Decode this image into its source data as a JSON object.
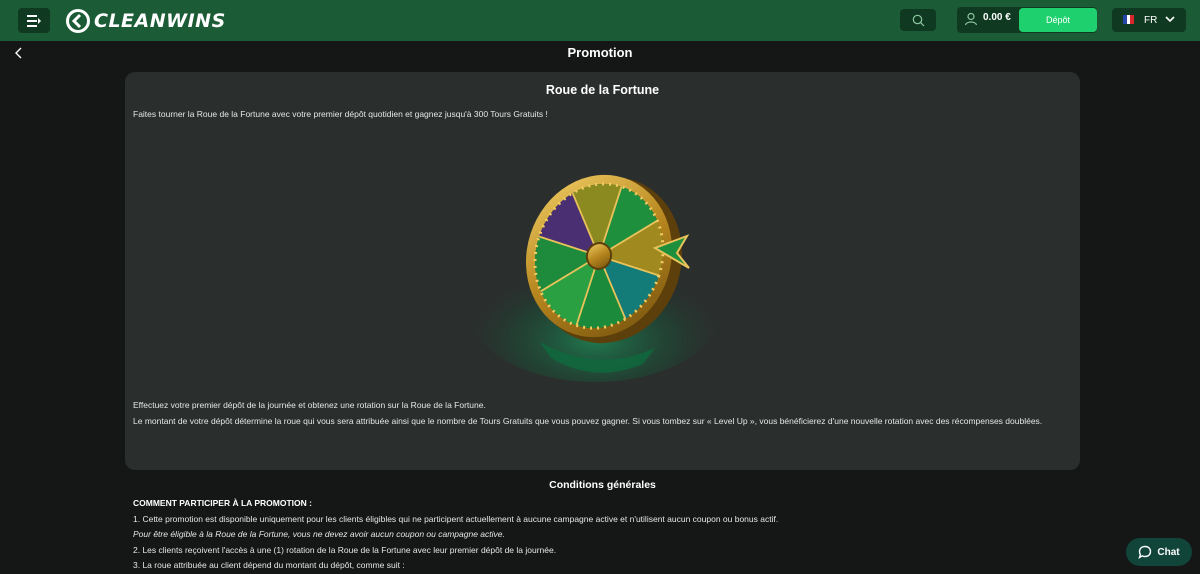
{
  "header": {
    "logo_text": "CLEANWINS",
    "balance": "0.00 €",
    "deposit_label": "Dépôt",
    "language": "FR",
    "icons": {
      "menu": "menu-icon",
      "search": "search-icon",
      "user": "user-icon",
      "flag": "france-flag-icon",
      "chevron": "chevron-down-icon"
    }
  },
  "page": {
    "title": "Promotion"
  },
  "card": {
    "title": "Roue de la Fortune",
    "intro": "Faites tourner la Roue de la Fortune avec votre premier dépôt quotidien et gagnez jusqu'à 300 Tours Gratuits !",
    "desc_line1": "Effectuez votre premier dépôt de la journée et obtenez une rotation sur la Roue de la Fortune.",
    "desc_line2": "Le montant de votre dépôt détermine la roue qui vous sera attribuée ainsi que le nombre de Tours Gratuits que vous pouvez gagner. Si vous tombez sur « Level Up », vous bénéficierez d'une nouvelle rotation avec des récompenses doublées."
  },
  "terms": {
    "title": "Conditions générales",
    "heading": "COMMENT PARTICIPER À LA PROMOTION :",
    "line1": "1. Cette promotion est disponible uniquement pour les clients éligibles qui ne participent actuellement à aucune campagne active et n'utilisent aucun coupon ou bonus actif.",
    "line1_note": "Pour être éligible à la Roue de la Fortune, vous ne devez avoir aucun coupon ou campagne active.",
    "line2": "2. Les clients reçoivent l'accès à une (1) rotation de la Roue de la Fortune avec leur premier dépôt de la journée.",
    "line3": "3. La roue attribuée au client dépend du montant du dépôt, comme suit :"
  },
  "chat": {
    "label": "Chat"
  },
  "colors": {
    "header_bg": "#1b5c36",
    "accent": "#1fd16e",
    "card_bg": "#2a2e2d",
    "page_bg": "#141716"
  }
}
